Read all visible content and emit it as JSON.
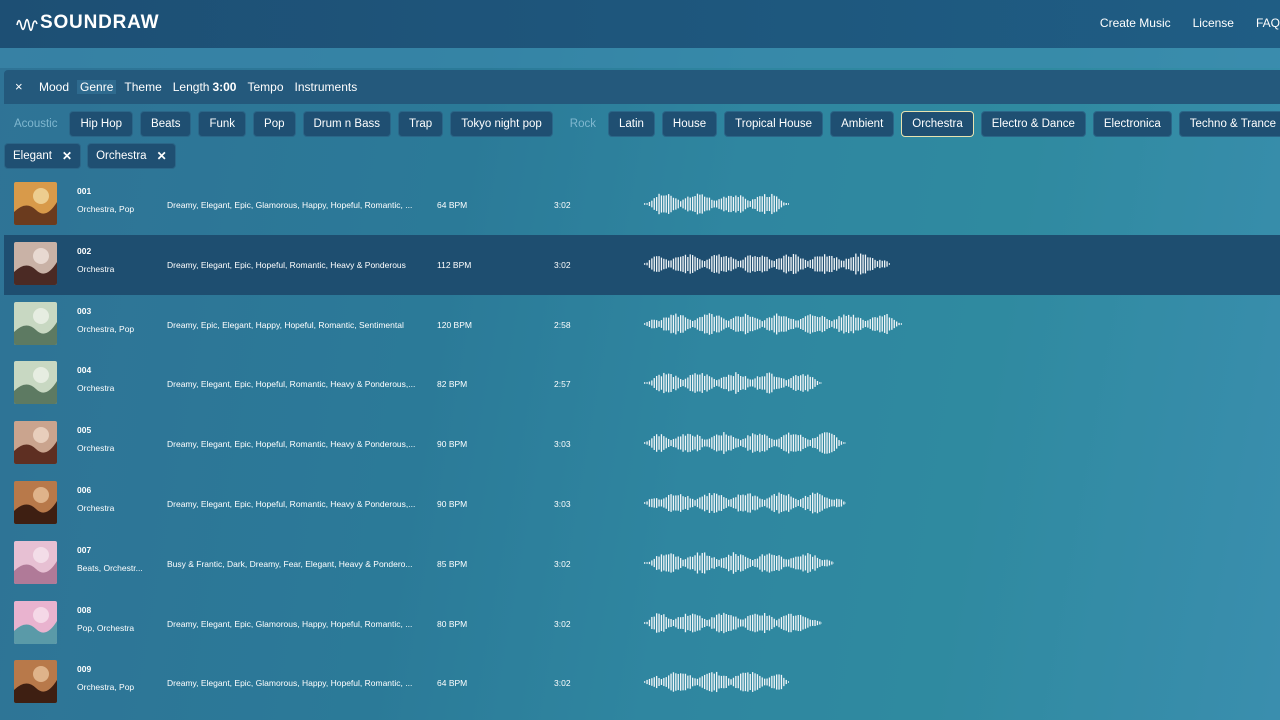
{
  "header": {
    "logo_text": "SOUNDRAW",
    "nav": [
      "Create Music",
      "License",
      "FAQ"
    ]
  },
  "filters": {
    "close_icon": "×",
    "tabs": [
      {
        "label": "Mood"
      },
      {
        "label": "Genre",
        "active": true
      },
      {
        "label": "Theme"
      },
      {
        "label": "Length",
        "value": "3:00"
      },
      {
        "label": "Tempo"
      },
      {
        "label": "Instruments"
      }
    ]
  },
  "genres": {
    "groups": [
      {
        "category": "Acoustic",
        "items": [
          "Hip Hop",
          "Beats",
          "Funk",
          "Pop",
          "Drum n Bass",
          "Trap",
          "Tokyo night pop"
        ]
      },
      {
        "category": "Rock",
        "items": [
          "Latin",
          "House",
          "Tropical House",
          "Ambient",
          "Orchestra",
          "Electro & Dance",
          "Electronica",
          "Techno & Trance"
        ]
      }
    ],
    "selected_highlight": "Orchestra"
  },
  "selected_tags": [
    {
      "label": "Elegant",
      "remove_icon": "✕"
    },
    {
      "label": "Orchestra",
      "remove_icon": "✕"
    }
  ],
  "tracks": [
    {
      "num": "001",
      "genre": "Orchestra, Pop",
      "moods": "Dreamy, Elegant, Epic, Glamorous, Happy, Hopeful, Romantic, ...",
      "bpm": "64 BPM",
      "length": "3:02",
      "thumb": [
        "#d89a4a",
        "#6b3b1e",
        "#f3d9a0"
      ],
      "wave_len": 145
    },
    {
      "num": "002",
      "genre": "Orchestra",
      "moods": "Dreamy, Elegant, Epic, Hopeful, Romantic, Heavy & Ponderous",
      "bpm": "112 BPM",
      "length": "3:02",
      "thumb": [
        "#c9b2a6",
        "#4b2a24",
        "#f0e2dc"
      ],
      "wave_len": 246,
      "highlight": true
    },
    {
      "num": "003",
      "genre": "Orchestra, Pop",
      "moods": "Dreamy, Epic, Elegant, Happy, Hopeful, Romantic, Sentimental",
      "bpm": "120 BPM",
      "length": "2:58",
      "thumb": [
        "#c8d8c2",
        "#5d7a62",
        "#eef3e8"
      ],
      "wave_len": 258
    },
    {
      "num": "004",
      "genre": "Orchestra",
      "moods": "Dreamy, Elegant, Epic, Hopeful, Romantic, Heavy & Ponderous,...",
      "bpm": "82 BPM",
      "length": "2:57",
      "thumb": [
        "#c8d8c2",
        "#5d7a62",
        "#eef3e8"
      ],
      "wave_len": 178
    },
    {
      "num": "005",
      "genre": "Orchestra",
      "moods": "Dreamy, Elegant, Epic, Hopeful, Romantic, Heavy & Ponderous,...",
      "bpm": "90 BPM",
      "length": "3:03",
      "thumb": [
        "#caa48e",
        "#5e2f22",
        "#efd8c8"
      ],
      "wave_len": 202
    },
    {
      "num": "006",
      "genre": "Orchestra",
      "moods": "Dreamy, Elegant, Epic, Hopeful, Romantic, Heavy & Ponderous,...",
      "bpm": "90 BPM",
      "length": "3:03",
      "thumb": [
        "#b8794a",
        "#3e1f12",
        "#e8c29a"
      ],
      "wave_len": 202
    },
    {
      "num": "007",
      "genre": "Beats, Orchestr...",
      "moods": "Busy & Frantic, Dark, Dreamy, Fear, Elegant, Heavy & Pondero...",
      "bpm": "85 BPM",
      "length": "3:02",
      "thumb": [
        "#e7c0d3",
        "#b07a98",
        "#f6e4ee"
      ],
      "wave_len": 190
    },
    {
      "num": "008",
      "genre": "Pop, Orchestra",
      "moods": "Dreamy, Elegant, Epic, Glamorous, Happy, Hopeful, Romantic, ...",
      "bpm": "80 BPM",
      "length": "3:02",
      "thumb": [
        "#e9b3cf",
        "#5a9aa8",
        "#f7e1ec"
      ],
      "wave_len": 178
    },
    {
      "num": "009",
      "genre": "Orchestra, Pop",
      "moods": "Dreamy, Elegant, Epic, Glamorous, Happy, Hopeful, Romantic, ...",
      "bpm": "64 BPM",
      "length": "3:02",
      "thumb": [
        "#b8794a",
        "#3e1f12",
        "#e8c29a"
      ],
      "wave_len": 145
    }
  ]
}
